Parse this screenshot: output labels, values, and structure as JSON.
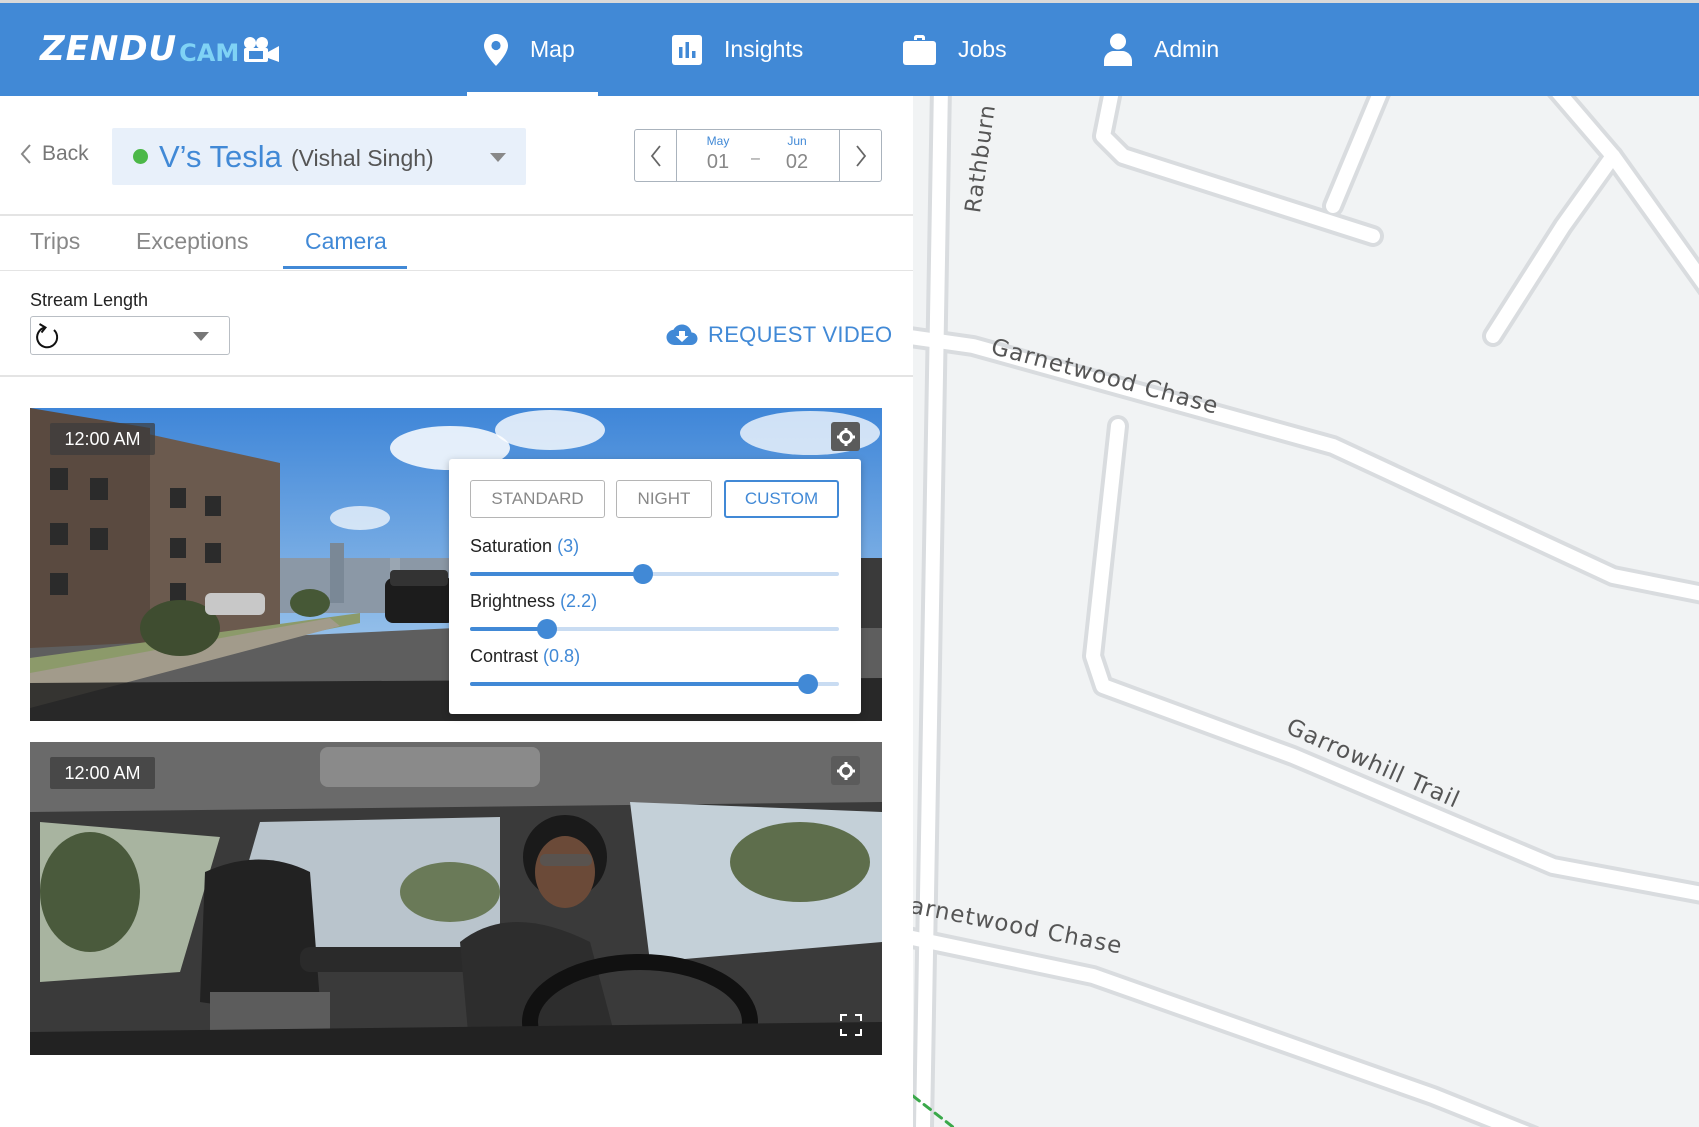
{
  "header": {
    "logo_text": "ZENDU",
    "logo_sub": "CAM",
    "nav": [
      {
        "label": "Map",
        "icon": "map-pin-icon"
      },
      {
        "label": "Insights",
        "icon": "bar-chart-icon"
      },
      {
        "label": "Jobs",
        "icon": "briefcase-icon"
      },
      {
        "label": "Admin",
        "icon": "user-icon"
      }
    ],
    "active_nav": "Map"
  },
  "vehicle_bar": {
    "back_label": "Back",
    "vehicle_name": "V’s Tesla",
    "driver_name": "(Vishal Singh)",
    "status_color": "#4cb848"
  },
  "date_range": {
    "start_month": "May",
    "start_day": "01",
    "separator": "–",
    "end_month": "Jun",
    "end_day": "02"
  },
  "tabs": [
    {
      "label": "Trips"
    },
    {
      "label": "Exceptions"
    },
    {
      "label": "Camera"
    }
  ],
  "active_tab": "Camera",
  "stream": {
    "label": "Stream Length",
    "request_label": "REQUEST VIDEO"
  },
  "videos": [
    {
      "timestamp": "12:00 AM",
      "view": "road"
    },
    {
      "timestamp": "12:00 AM",
      "view": "cabin"
    }
  ],
  "camera_settings": {
    "modes": [
      {
        "label": "STANDARD",
        "active": false
      },
      {
        "label": "NIGHT",
        "active": false
      },
      {
        "label": "CUSTOM",
        "active": true
      }
    ],
    "sliders": [
      {
        "label": "Saturation",
        "value_text": "(3)",
        "fraction": 0.47
      },
      {
        "label": "Brightness",
        "value_text": "(2.2)",
        "fraction": 0.21
      },
      {
        "label": "Contrast",
        "value_text": "(0.8)",
        "fraction": 0.915
      }
    ]
  },
  "map": {
    "streets": [
      "Rathburn",
      "Garnetwood Chase",
      "Garrowhill Trail",
      "arnetwood Chase"
    ]
  },
  "colors": {
    "brand_blue": "#4189d6",
    "logo_cam": "#7fd2f5",
    "map_background": "#f1f3f4"
  }
}
